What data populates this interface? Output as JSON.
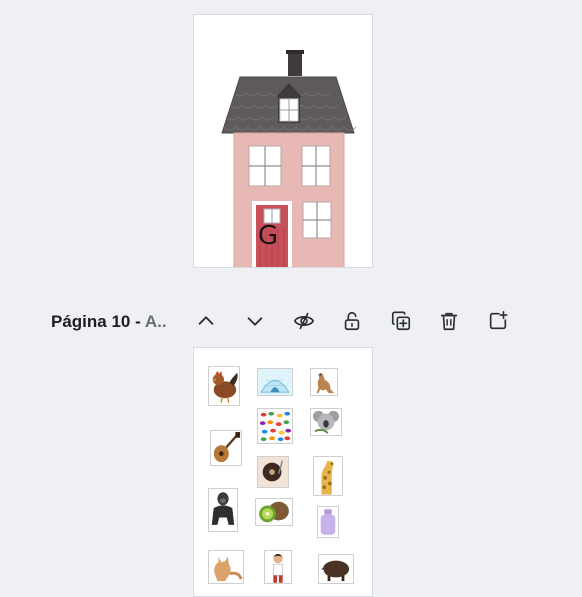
{
  "toolbar": {
    "page_title": "Página 10 - ",
    "page_subtitle": "A..",
    "icons": [
      "chevron-up-icon",
      "chevron-down-icon",
      "hide-eye-icon",
      "unlock-icon",
      "duplicate-icon",
      "trash-icon",
      "add-page-icon"
    ]
  },
  "page_top": {
    "letter": "G"
  },
  "colors": {
    "background": "#eef0f3",
    "roof": "#5f5a5e",
    "wall": "#e8b9b4",
    "door": "#c8505a",
    "icon": "#2b2d33"
  },
  "stickers": [
    "hen",
    "igloo",
    "kangaroo",
    "guitar",
    "gummy-candies",
    "koala",
    "record-player",
    "giraffe",
    "gorilla",
    "kiwi",
    "lavender-bottle",
    "cat",
    "person",
    "wild-boar"
  ]
}
